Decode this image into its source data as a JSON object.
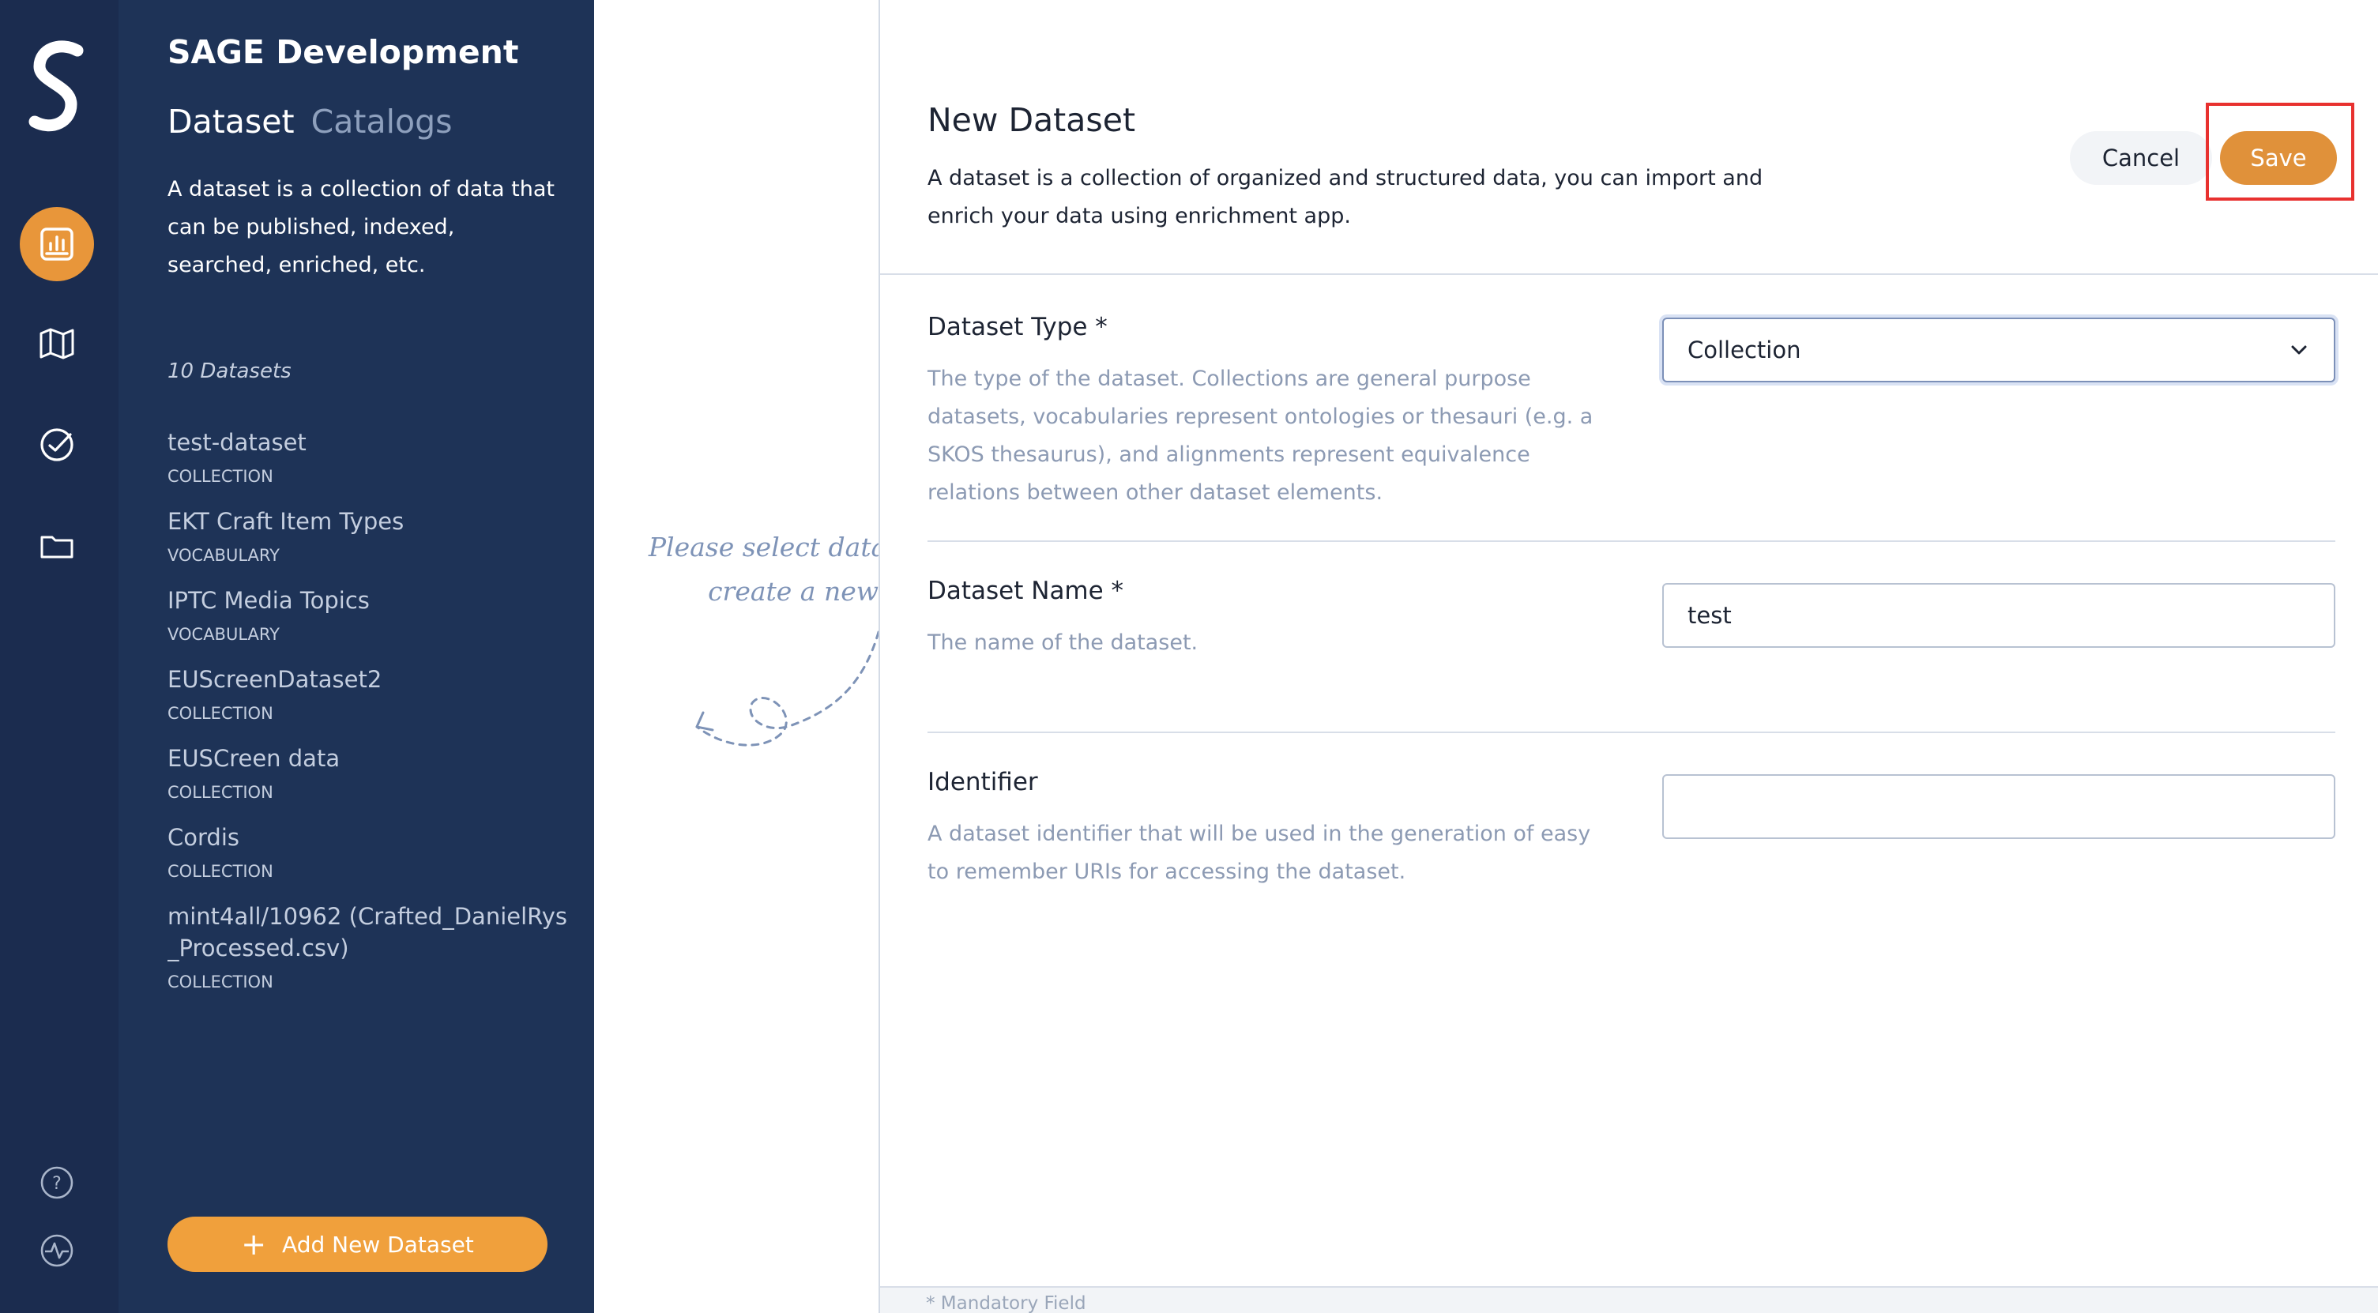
{
  "app": {
    "title": "SAGE Development"
  },
  "rail": {
    "icons": [
      "sage-logo-icon",
      "datasets-chart-icon",
      "map-icon",
      "check-circle-icon",
      "folder-icon",
      "help-icon",
      "activity-icon"
    ],
    "active_color": "#e8963a"
  },
  "sidebar": {
    "tabs": [
      {
        "label": "Dataset",
        "active": true
      },
      {
        "label": "Catalogs",
        "active": false
      }
    ],
    "description": "A dataset is a collection of data that can be published, indexed, searched, enriched, etc.",
    "count_label": "10 Datasets",
    "datasets": [
      {
        "name": "test-dataset",
        "type": "COLLECTION"
      },
      {
        "name": "EKT Craft Item Types",
        "type": "VOCABULARY"
      },
      {
        "name": "IPTC Media Topics",
        "type": "VOCABULARY"
      },
      {
        "name": "EUScreenDataset2",
        "type": "COLLECTION"
      },
      {
        "name": "EUSCreen data",
        "type": "COLLECTION"
      },
      {
        "name": "Cordis",
        "type": "COLLECTION"
      },
      {
        "name": "mint4all/10962 (Crafted_DanielRys_Processed.csv)",
        "type": "COLLECTION"
      }
    ],
    "add_button_label": "Add New Dataset"
  },
  "placeholder": {
    "line1": "Please select dataset",
    "line2": "create a new"
  },
  "form": {
    "title": "New Dataset",
    "subtitle": "A dataset is a collection of organized and structured data, you can import and enrich your data using enrichment app.",
    "cancel_label": "Cancel",
    "save_label": "Save",
    "fields": {
      "type": {
        "label": "Dataset Type *",
        "help": "The type of the dataset. Collections are general purpose datasets, vocabularies represent ontologies or thesauri (e.g. a SKOS thesaurus), and alignments represent equivalence relations between other dataset elements.",
        "value": "Collection"
      },
      "name": {
        "label": "Dataset Name *",
        "help": "The name of the dataset.",
        "value": "test"
      },
      "identifier": {
        "label": "Identifier",
        "help": "A dataset identifier that will be used in the generation of easy to remember URIs for accessing the dataset.",
        "value": ""
      }
    },
    "footer_note": "* Mandatory Field"
  },
  "colors": {
    "rail_bg": "#1b2c4f",
    "sidebar_bg": "#1e3357",
    "accent_orange": "#f0a03c",
    "highlight_red": "#e8312f"
  }
}
